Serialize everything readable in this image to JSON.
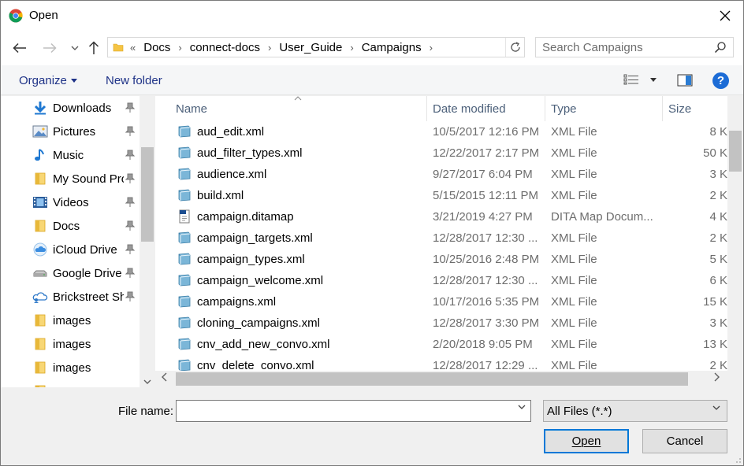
{
  "window": {
    "title": "Open"
  },
  "address": {
    "crumbs": [
      "Docs",
      "connect-docs",
      "User_Guide",
      "Campaigns"
    ],
    "lead": "«",
    "separator": "›",
    "search_placeholder": "Search Campaigns"
  },
  "toolbar": {
    "organize_label": "Organize",
    "new_folder_label": "New folder",
    "help_label": "?"
  },
  "sidebar": {
    "items": [
      {
        "label": "Downloads",
        "icon": "download-arrow-icon",
        "pinned": true
      },
      {
        "label": "Pictures",
        "icon": "pictures-icon",
        "pinned": true
      },
      {
        "label": "Music",
        "icon": "music-note-icon",
        "pinned": true
      },
      {
        "label": "My Sound Pro",
        "icon": "folder-icon",
        "pinned": true
      },
      {
        "label": "Videos",
        "icon": "videos-icon",
        "pinned": true
      },
      {
        "label": "Docs",
        "icon": "folder-icon",
        "pinned": true
      },
      {
        "label": "iCloud Drive",
        "icon": "cloud-icon",
        "pinned": true
      },
      {
        "label": "Google Drive",
        "icon": "drive-icon",
        "pinned": true
      },
      {
        "label": "Brickstreet Sh",
        "icon": "cloud-people-icon",
        "pinned": true
      },
      {
        "label": "images",
        "icon": "folder-icon",
        "pinned": false
      },
      {
        "label": "images",
        "icon": "folder-icon",
        "pinned": false
      },
      {
        "label": "images",
        "icon": "folder-icon",
        "pinned": false
      }
    ]
  },
  "columns": {
    "name": "Name",
    "date": "Date modified",
    "type": "Type",
    "size": "Size"
  },
  "files": [
    {
      "name": "aud_edit.xml",
      "date": "10/5/2017 12:16 PM",
      "type": "XML File",
      "size": "8 K",
      "icon": "xml-file-icon"
    },
    {
      "name": "aud_filter_types.xml",
      "date": "12/22/2017 2:17 PM",
      "type": "XML File",
      "size": "50 K",
      "icon": "xml-file-icon"
    },
    {
      "name": "audience.xml",
      "date": "9/27/2017 6:04 PM",
      "type": "XML File",
      "size": "3 K",
      "icon": "xml-file-icon"
    },
    {
      "name": "build.xml",
      "date": "5/15/2015 12:11 PM",
      "type": "XML File",
      "size": "2 K",
      "icon": "xml-file-icon"
    },
    {
      "name": "campaign.ditamap",
      "date": "3/21/2019 4:27 PM",
      "type": "DITA Map Docum...",
      "size": "4 K",
      "icon": "ditamap-file-icon"
    },
    {
      "name": "campaign_targets.xml",
      "date": "12/28/2017 12:30 ...",
      "type": "XML File",
      "size": "2 K",
      "icon": "xml-file-icon"
    },
    {
      "name": "campaign_types.xml",
      "date": "10/25/2016 2:48 PM",
      "type": "XML File",
      "size": "5 K",
      "icon": "xml-file-icon"
    },
    {
      "name": "campaign_welcome.xml",
      "date": "12/28/2017 12:30 ...",
      "type": "XML File",
      "size": "6 K",
      "icon": "xml-file-icon"
    },
    {
      "name": "campaigns.xml",
      "date": "10/17/2016 5:35 PM",
      "type": "XML File",
      "size": "15 K",
      "icon": "xml-file-icon"
    },
    {
      "name": "cloning_campaigns.xml",
      "date": "12/28/2017 3:30 PM",
      "type": "XML File",
      "size": "3 K",
      "icon": "xml-file-icon"
    },
    {
      "name": "cnv_add_new_convo.xml",
      "date": "2/20/2018 9:05 PM",
      "type": "XML File",
      "size": "13 K",
      "icon": "xml-file-icon"
    },
    {
      "name": "cnv_delete_convo.xml",
      "date": "12/28/2017 12:29 ...",
      "type": "XML File",
      "size": "2 K",
      "icon": "xml-file-icon"
    }
  ],
  "footer": {
    "file_name_label": "File name:",
    "file_name_value": "",
    "filter_value": "All Files (*.*)",
    "open_label": "Open",
    "cancel_label": "Cancel"
  },
  "colors": {
    "link_blue": "#1e3287",
    "header_text": "#4c607a",
    "secondary_text": "#6d6d6d",
    "accent": "#0078d7"
  }
}
